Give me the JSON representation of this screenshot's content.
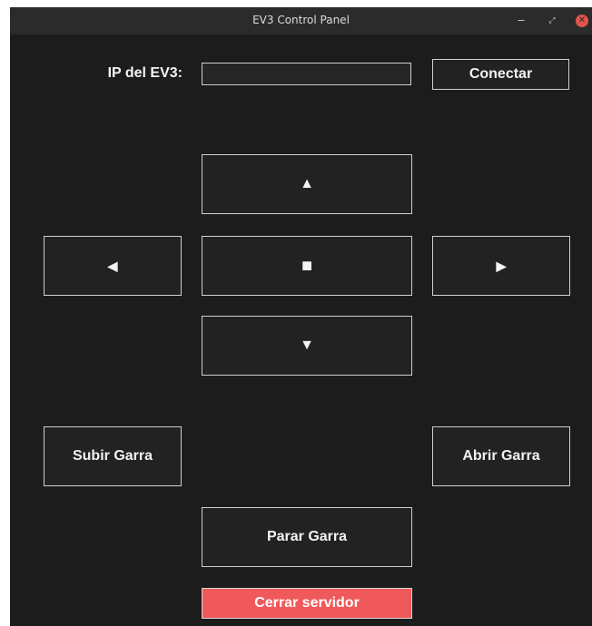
{
  "window": {
    "title": "EV3 Control Panel",
    "minimize_glyph": "−",
    "maximize_glyph": "⤢",
    "close_glyph": "✕"
  },
  "connection": {
    "ip_label": "IP del EV3:",
    "ip_value": "",
    "connect_label": "Conectar"
  },
  "movement": {
    "up_label": "▲",
    "left_label": "◀",
    "stop_label": "■",
    "right_label": "▶",
    "down_label": "▼"
  },
  "claw": {
    "raise_label": "Subir Garra",
    "open_label": "Abrir Garra",
    "stop_label": "Parar Garra"
  },
  "server": {
    "close_label": "Cerrar servidor"
  },
  "colors": {
    "window_bg": "#1c1c1c",
    "titlebar_bg": "#2b2b2b",
    "close_server_bg": "#f0595b",
    "window_close_bg": "#e0554e"
  }
}
